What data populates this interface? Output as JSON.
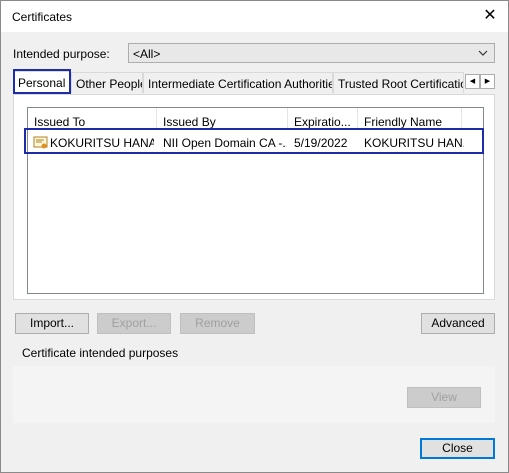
{
  "window": {
    "title": "Certificates"
  },
  "intended_purpose": {
    "label": "Intended purpose:",
    "value": "<All>"
  },
  "tabs": [
    {
      "label": "Personal",
      "active": true
    },
    {
      "label": "Other People",
      "active": false
    },
    {
      "label": "Intermediate Certification Authorities",
      "active": false
    },
    {
      "label": "Trusted Root Certification",
      "active": false
    }
  ],
  "columns": [
    "Issued To",
    "Issued By",
    "Expiratio...",
    "Friendly Name"
  ],
  "rows": [
    {
      "issued_to": "KOKURITSU HANAKO",
      "issued_by": "NII Open Domain CA -...",
      "expiration": "5/19/2022",
      "friendly_name": "KOKURITSU HAN..."
    }
  ],
  "buttons": {
    "import": "Import...",
    "export": "Export...",
    "remove": "Remove",
    "advanced": "Advanced",
    "view": "View",
    "close": "Close"
  },
  "purposes_group": {
    "label": "Certificate intended purposes"
  },
  "colors": {
    "highlight": "#1e2ca8",
    "default_button": "#0078d7"
  }
}
